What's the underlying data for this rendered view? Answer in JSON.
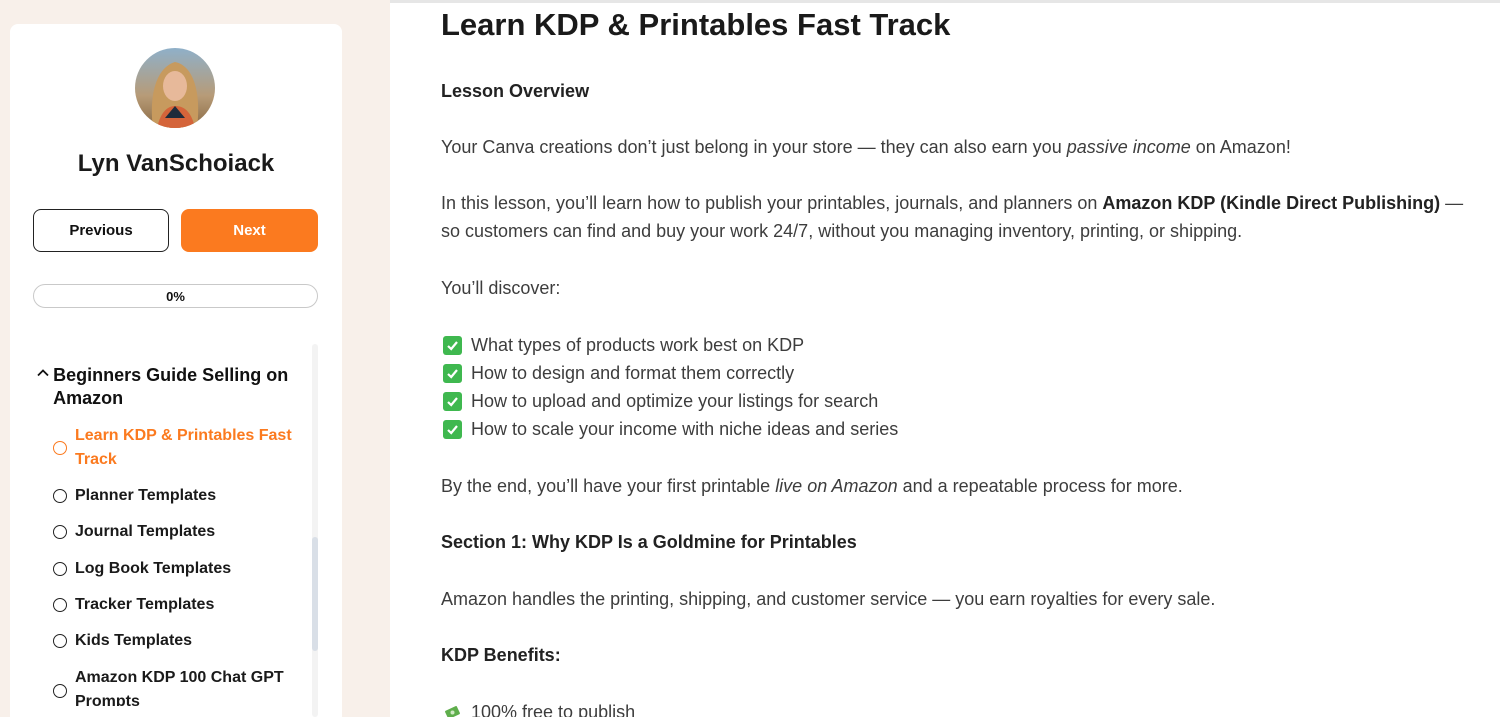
{
  "author": {
    "name": "Lyn VanSchoiack"
  },
  "nav": {
    "previous_label": "Previous",
    "next_label": "Next"
  },
  "progress": {
    "label": "0%",
    "value": 0
  },
  "sidebar": {
    "module_title": "Beginners Guide Selling on Amazon",
    "lessons": [
      {
        "label": "Learn KDP & Printables Fast Track",
        "active": true
      },
      {
        "label": "Planner Templates"
      },
      {
        "label": "Journal Templates"
      },
      {
        "label": "Log Book Templates"
      },
      {
        "label": "Tracker Templates"
      },
      {
        "label": "Kids Templates"
      },
      {
        "label": "Amazon KDP 100 Chat GPT Prompts"
      }
    ]
  },
  "lesson": {
    "title": "Learn KDP & Printables Fast Track",
    "overview_heading": "Lesson Overview",
    "p1_a": "Your Canva creations don’t just belong in your store — they can also earn you ",
    "p1_em": "passive income",
    "p1_b": " on Amazon!",
    "p2_a": "In this lesson, you’ll learn how to publish your printables, journals, and planners on ",
    "p2_bold": "Amazon KDP (Kindle Direct Publishing)",
    "p2_b": " — so customers can find and buy your work 24/7, without you managing inventory, printing, or shipping.",
    "discover": "You’ll discover:",
    "checklist": [
      "What types of products work best on KDP",
      "How to design and format them correctly",
      "How to upload and optimize your listings for search",
      "How to scale your income with niche ideas and series"
    ],
    "p3_a": "By the end, you’ll have your first printable ",
    "p3_em": "live on Amazon",
    "p3_b": " and a repeatable process for more.",
    "section1_heading": "Section 1: Why KDP Is a Goldmine for Printables",
    "section1_text": "Amazon handles the printing, shipping, and customer service — you earn royalties for every sale.",
    "benefits_heading": "KDP Benefits:",
    "benefit_1": "100% free to publish"
  },
  "colors": {
    "accent": "#fb7a1f",
    "check_green": "#3fb84f",
    "sidebar_bg": "#f8f0ea"
  },
  "icons": {
    "check": "check-box-icon",
    "money": "money-with-wings-icon",
    "collapse": "chevron-up-icon",
    "lesson_status": "circle-icon"
  }
}
